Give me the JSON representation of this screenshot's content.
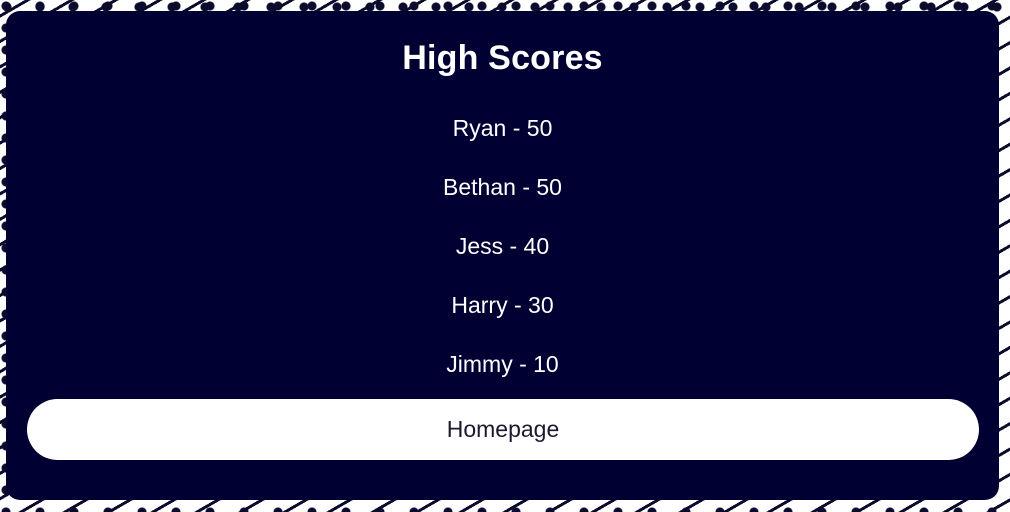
{
  "title": "High Scores",
  "scores": [
    {
      "text": "Ryan - 50"
    },
    {
      "text": "Bethan - 50"
    },
    {
      "text": "Jess - 40"
    },
    {
      "text": "Harry - 30"
    },
    {
      "text": "Jimmy - 10"
    }
  ],
  "home_button_label": "Homepage",
  "colors": {
    "card_background": "#000033",
    "text": "#ffffff",
    "button_background": "#ffffff",
    "button_text": "#1a1a2e"
  }
}
